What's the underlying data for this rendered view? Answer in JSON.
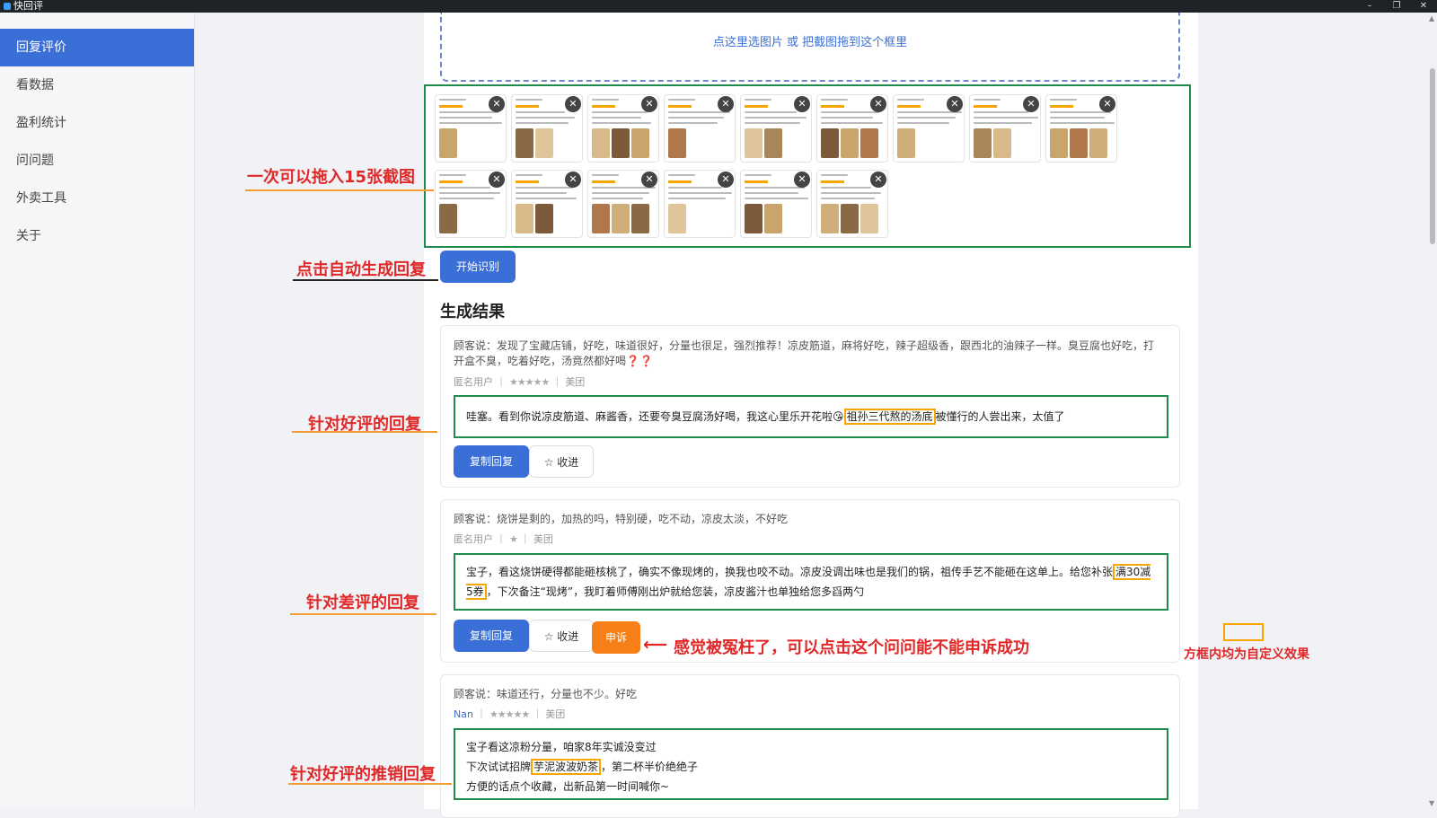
{
  "window": {
    "title": "快回评"
  },
  "sidebar": {
    "items": [
      {
        "label": "回复评价",
        "active": true
      },
      {
        "label": "看数据"
      },
      {
        "label": "盈利统计"
      },
      {
        "label": "问问题"
      },
      {
        "label": "外卖工具"
      },
      {
        "label": "关于"
      }
    ]
  },
  "upload": {
    "hint": "点这里选图片 或 把截图拖到这个框里",
    "thumbnail_count": 15
  },
  "actions": {
    "start_label": "开始识别"
  },
  "results": {
    "title": "生成结果",
    "cards": [
      {
        "customer": "顾客说：发现了宝藏店铺，好吃，味道很好，分量也很足，强烈推荐！凉皮筋道，麻将好吃，辣子超级香，跟西北的油辣子一样。臭豆腐也好吃，打开盒不臭，吃着好吃，汤竟然都好喝❓❓",
        "user": "匿名用户",
        "stars": "★★★★★",
        "platform": "美团",
        "reply": {
          "before": "哇塞。看到你说凉皮筋道、麻酱香，还要夸臭豆腐汤好喝，我这心里乐开花啦😘",
          "highlight": "祖孙三代熬的汤底",
          "after": "被懂行的人尝出来，太值了"
        },
        "copy_label": "复制回复",
        "fav_label": "☆ 收进"
      },
      {
        "customer": "顾客说：烧饼是剩的，加热的吗，特别硬，吃不动，凉皮太淡，不好吃",
        "user": "匿名用户",
        "stars": "★",
        "platform": "美团",
        "reply": {
          "before": "宝子，看这烧饼硬得都能砸核桃了，确实不像现烤的，换我也咬不动。凉皮没调出味也是我们的锅，祖传手艺不能砸在这单上。给您补张",
          "highlight": "满30减5券",
          "after": "，下次备注“现烤”，我盯着师傅刚出炉就给您装，凉皮酱汁也单独给您多舀两勺"
        },
        "copy_label": "复制回复",
        "fav_label": "☆ 收进",
        "appeal_label": "申诉"
      },
      {
        "customer": "顾客说：味道还行，分量也不少。好吃",
        "user": "Nan",
        "stars": "★★★★★",
        "platform": "美团",
        "reply": {
          "line1": "宝子看这凉粉分量，咱家8年实诚没变过",
          "line2_before": "下次试试招牌",
          "highlight": "芋泥波波奶茶",
          "line2_after": "，第二杯半价绝绝子",
          "line3": "方便的话点个收藏，出新品第一时间喊你~"
        }
      }
    ]
  },
  "annotations": {
    "drag15": "一次可以拖入15张截图",
    "auto_reply": "点击自动生成回复",
    "good_reply": "针对好评的回复",
    "bad_reply": "针对差评的回复",
    "appeal_hint": "感觉被冤枉了，可以点击这个问问能不能申诉成功",
    "promo_reply": "针对好评的推销回复",
    "legend": "方框内均为自定义效果"
  },
  "colors": {
    "accent": "#3b6fd8",
    "frame_green": "#1e8a4c",
    "highlight_orange": "#f7a600",
    "annotation_red": "#e02828",
    "appeal": "#f77f18"
  }
}
